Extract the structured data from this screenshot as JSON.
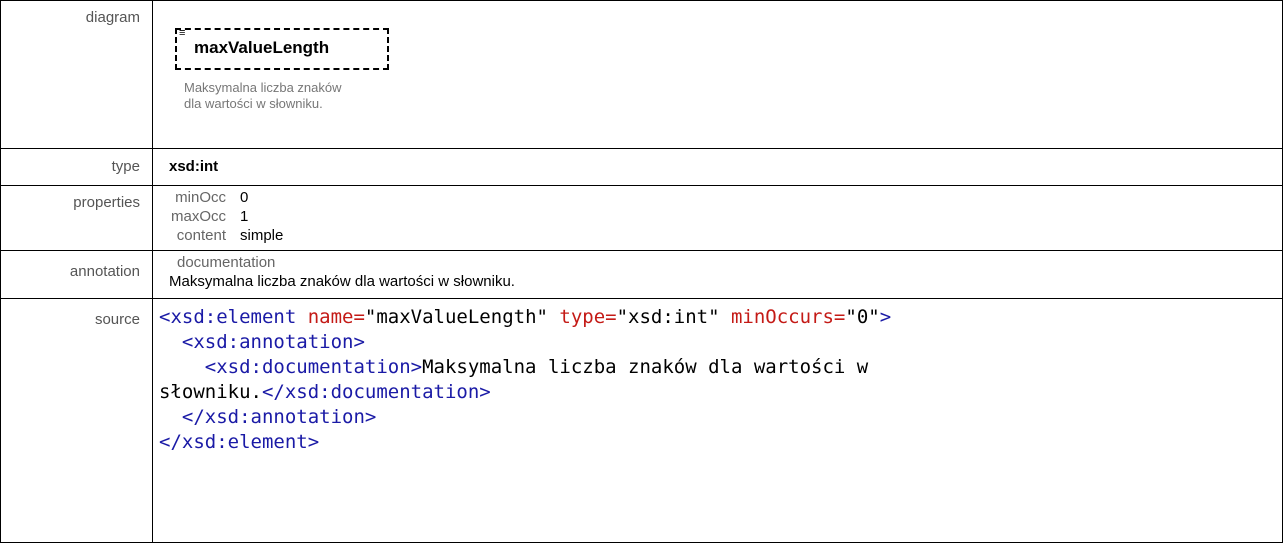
{
  "rows": {
    "diagram": {
      "label": "diagram",
      "element_name": "maxValueLength",
      "doc_line1": "Maksymalna liczba znaków",
      "doc_line2": "dla wartości w słowniku."
    },
    "type": {
      "label": "type",
      "value": "xsd:int"
    },
    "properties": {
      "label": "properties",
      "items": [
        {
          "key": "minOcc",
          "value": "0"
        },
        {
          "key": "maxOcc",
          "value": "1"
        },
        {
          "key": "content",
          "value": "simple"
        }
      ]
    },
    "annotation": {
      "label": "annotation",
      "heading": "documentation",
      "text": "Maksymalna liczba znaków dla wartości w słowniku."
    },
    "source": {
      "label": "source",
      "tag_element_open": "<xsd:element",
      "attr_name": " name=",
      "val_name": "\"maxValueLength\"",
      "attr_type": " type=",
      "val_type": "\"xsd:int\"",
      "attr_min": " minOccurs=",
      "val_min": "\"0\"",
      "close_gt": ">",
      "tag_annotation_open": "<xsd:annotation>",
      "tag_documentation_open": "<xsd:documentation>",
      "doc_text_1": "Maksymalna liczba znaków dla wartości w",
      "doc_text_2": "słowniku.",
      "tag_documentation_close": "</xsd:documentation>",
      "tag_annotation_close": "</xsd:annotation>",
      "tag_element_close": "</xsd:element>"
    }
  },
  "colors": {
    "tag": "#1a1aa6",
    "attribute": "#c41a16",
    "label_text": "#555555"
  }
}
